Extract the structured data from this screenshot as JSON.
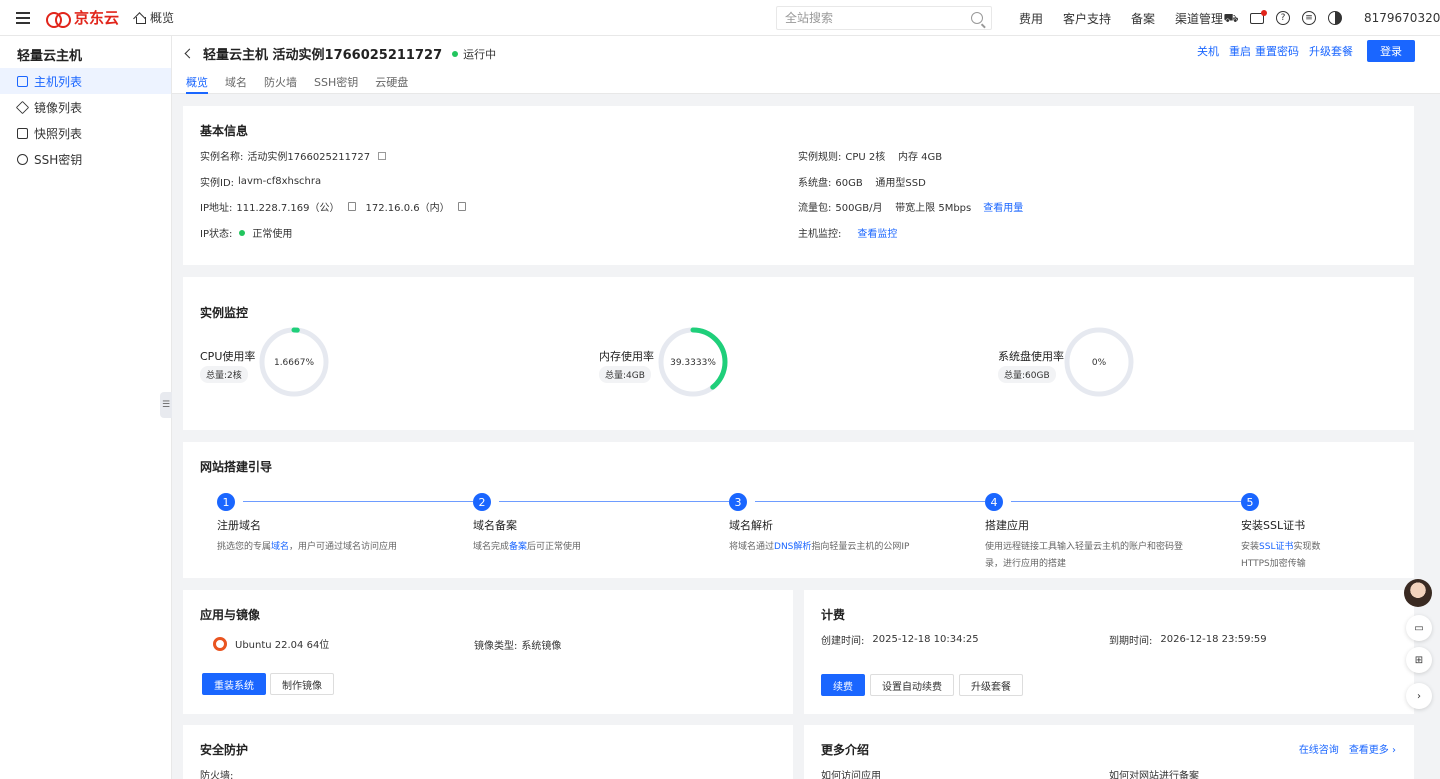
{
  "topbar": {
    "brand": "京东云",
    "home_label": "概览",
    "search_placeholder": "全站搜索",
    "links": [
      "费用",
      "客户支持",
      "备案",
      "渠道管理"
    ],
    "account": "8179670320"
  },
  "sidebar": {
    "title": "轻量云主机",
    "items": [
      {
        "label": "主机列表",
        "active": true
      },
      {
        "label": "镜像列表",
        "active": false
      },
      {
        "label": "快照列表",
        "active": false
      },
      {
        "label": "SSH密钥",
        "active": false
      }
    ]
  },
  "header": {
    "title": "轻量云主机 活动实例1766025211727",
    "status": "运行中",
    "tabs": [
      "概览",
      "域名",
      "防火墙",
      "SSH密钥",
      "云硬盘"
    ],
    "actions": [
      "关机",
      "重启",
      "重置密码",
      "升级套餐"
    ],
    "login_label": "登录"
  },
  "basic_info": {
    "title": "基本信息",
    "name_label": "实例名称:",
    "name_value": "活动实例1766025211727",
    "id_label": "实例ID:",
    "id_value": "lavm-cf8xhschra",
    "ip_label": "IP地址:",
    "ip_public": "111.228.7.169（公）",
    "ip_private": "172.16.0.6（内）",
    "ip_status_label": "IP状态:",
    "ip_status_value": "正常使用",
    "spec_label": "实例规则:",
    "spec_value": "CPU 2核    内存 4GB",
    "disk_label": "系统盘:",
    "disk_value": "60GB    通用型SSD",
    "traffic_label": "流量包:",
    "traffic_value": "500GB/月    带宽上限 5Mbps",
    "traffic_link": "查看用量",
    "monitor_label": "主机监控:",
    "monitor_link": "查看监控"
  },
  "monitor": {
    "title": "实例监控",
    "gauges": [
      {
        "label": "CPU使用率",
        "total": "总量:2核",
        "percent": 1.6667,
        "text": "1.6667%"
      },
      {
        "label": "内存使用率",
        "total": "总量:4GB",
        "percent": 39.3333,
        "text": "39.3333%"
      },
      {
        "label": "系统盘使用率",
        "total": "总量:60GB",
        "percent": 0,
        "text": "0%"
      }
    ],
    "colors": {
      "track": "#e6e9f0",
      "fill": "#1fcf7a"
    }
  },
  "guide": {
    "title": "网站搭建引导",
    "steps": [
      {
        "num": "1",
        "title": "注册域名",
        "pre": "挑选您的专属",
        "link": "域名",
        "post": "，用户可通过域名访问应用"
      },
      {
        "num": "2",
        "title": "域名备案",
        "pre": "域名完成",
        "link": "备案",
        "post": "后可正常使用"
      },
      {
        "num": "3",
        "title": "域名解析",
        "pre": "将域名通过",
        "link": "DNS解析",
        "post": "指向轻量云主机的公网IP"
      },
      {
        "num": "4",
        "title": "搭建应用",
        "pre": "使用远程链接工具输入轻量云主机的账户和密码登录，进行应用的搭建",
        "link": "",
        "post": ""
      },
      {
        "num": "5",
        "title": "安装SSL证书",
        "pre": "安装",
        "link": "SSL证书",
        "post": "实现数HTTPS加密传输"
      }
    ]
  },
  "apps": {
    "title": "应用与镜像",
    "os": "Ubuntu 22.04 64位",
    "image_type_label": "镜像类型:",
    "image_type_value": "系统镜像",
    "reinstall_label": "重装系统",
    "make_image_label": "制作镜像"
  },
  "billing": {
    "title": "计费",
    "created_label": "创建时间:",
    "created_value": "2025-12-18 10:34:25",
    "expire_label": "到期时间:",
    "expire_value": "2026-12-18 23:59:59",
    "renew_label": "续费",
    "auto_renew_label": "设置自动续费",
    "upgrade_label": "升级套餐"
  },
  "security": {
    "title": "安全防护",
    "firewall_label": "防火墙:"
  },
  "more": {
    "title": "更多介绍",
    "consult_link": "在线咨询",
    "more_link": "查看更多",
    "item1": "如何访问应用",
    "item2": "如何对网站进行备案"
  }
}
